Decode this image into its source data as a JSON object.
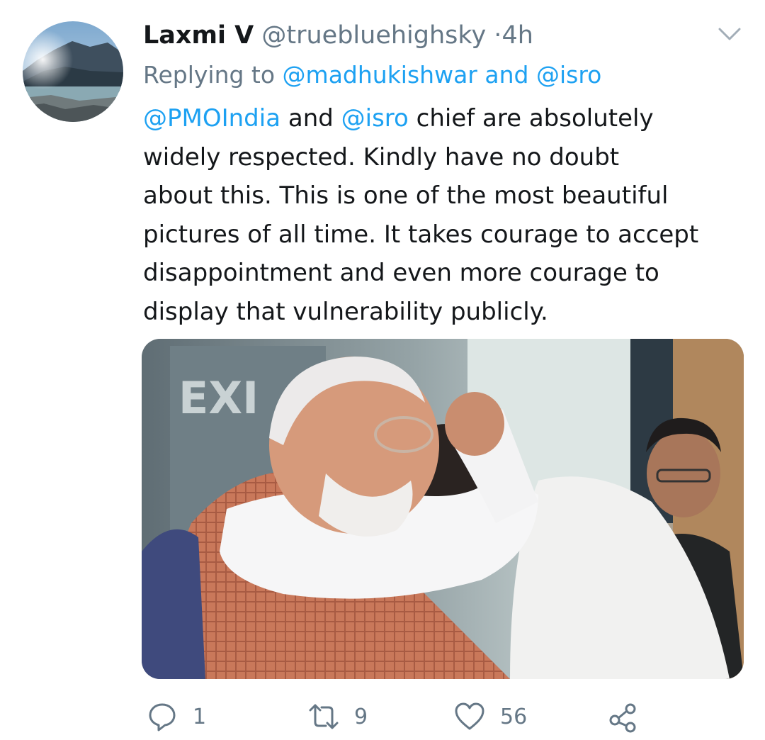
{
  "tweet": {
    "author_name": "Laxmi V",
    "author_handle": "@truebluehighsky",
    "separator": "·",
    "timestamp": "4h",
    "reply_prefix": "Replying to",
    "reply_mention_1": "@madhukishwar",
    "reply_and": "and",
    "reply_mention_2": "@isro",
    "body": {
      "mention_1": "@PMOIndia",
      "and": "and",
      "mention_2": "@isro",
      "line_1_rest": "chief are absolutely",
      "line_2": "widely respected. Kindly have no doubt",
      "line_3": "about this. This is one of the most beautiful",
      "line_4": "pictures of all time. It takes courage to accept",
      "line_5": "disappointment and even more courage to",
      "line_6": "display that vulnerability publicly."
    },
    "media_sign_text": "EXI",
    "stats": {
      "replies": "1",
      "retweets": "9",
      "likes": "56"
    },
    "icons": {
      "menu": "chevron-down-icon",
      "reply": "reply-icon",
      "retweet": "retweet-icon",
      "like": "heart-icon",
      "share": "share-icon"
    }
  },
  "colors": {
    "link": "#1da1f2",
    "secondary_text": "#657786",
    "primary_text": "#14171a"
  }
}
